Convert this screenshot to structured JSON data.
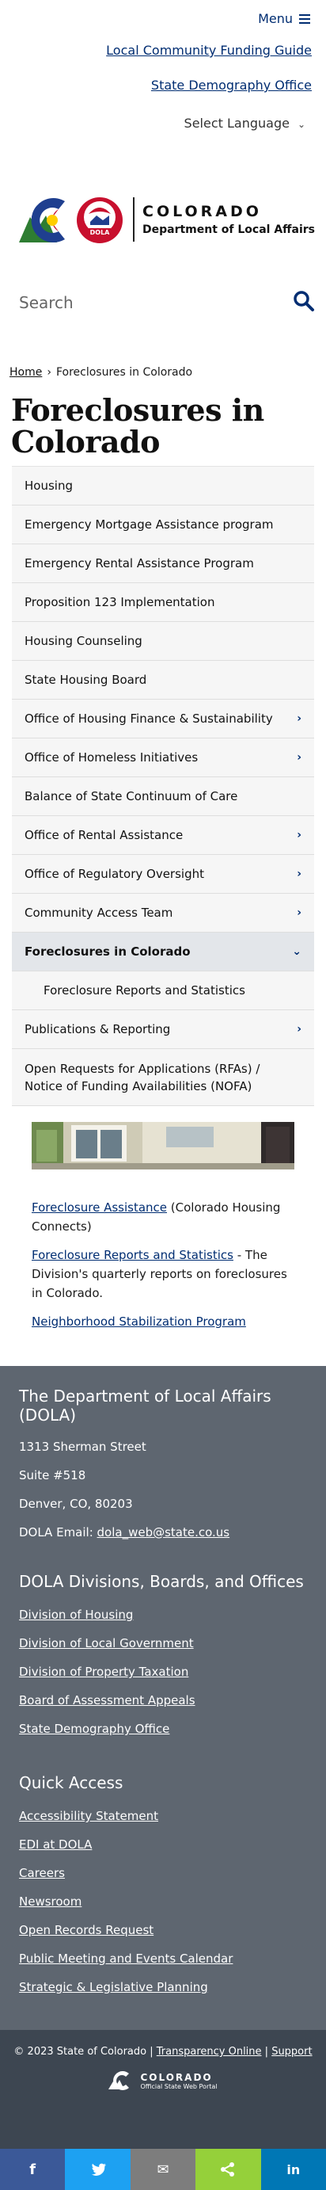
{
  "header": {
    "menu_label": "Menu",
    "links": [
      "Local Community Funding Guide",
      "State Demography Office"
    ],
    "language_label": "Select Language",
    "logo": {
      "name": "COLORADO",
      "department": "Department of Local Affairs",
      "badge": "DOLA"
    }
  },
  "search": {
    "placeholder": "Search"
  },
  "breadcrumb": {
    "home": "Home",
    "current": "Foreclosures in Colorado"
  },
  "page_title": "Foreclosures in Colorado",
  "nav": {
    "items": [
      {
        "label": "Housing",
        "chevron": false
      },
      {
        "label": "Emergency Mortgage Assistance program",
        "chevron": false
      },
      {
        "label": "Emergency Rental Assistance Program",
        "chevron": false
      },
      {
        "label": "Proposition 123 Implementation",
        "chevron": false
      },
      {
        "label": "Housing Counseling",
        "chevron": false
      },
      {
        "label": "State Housing Board",
        "chevron": false
      },
      {
        "label": "Office of Housing Finance & Sustainability",
        "chevron": true
      },
      {
        "label": "Office of Homeless Initiatives",
        "chevron": true
      },
      {
        "label": "Balance of State Continuum of Care",
        "chevron": false
      },
      {
        "label": "Office of Rental Assistance",
        "chevron": true
      },
      {
        "label": "Office of Regulatory Oversight",
        "chevron": true
      },
      {
        "label": "Community Access Team",
        "chevron": true
      },
      {
        "label": "Foreclosures in Colorado",
        "chevron": true,
        "active": true
      },
      {
        "label": "Foreclosure Reports and Statistics",
        "sub": true
      },
      {
        "label": "Publications & Reporting",
        "chevron": true
      },
      {
        "label": "Open Requests for Applications (RFAs) / Notice of Funding Availabilities (NOFA)",
        "chevron": false
      }
    ]
  },
  "content": {
    "p1_link": "Foreclosure Assistance",
    "p1_text": " (Colorado Housing Connects)",
    "p2_link": "Foreclosure Reports and Statistics",
    "p2_text": " - The Division's quarterly reports on foreclosures in Colorado.",
    "p3_link": "Neighborhood Stabilization Program"
  },
  "footer": {
    "dept_title": "The Department of Local Affairs (DOLA)",
    "address_line1": "1313 Sherman Street",
    "address_line2": "Suite  #518",
    "address_line3": "Denver, CO, 80203",
    "email_label": "DOLA Email: ",
    "email": "dola_web@state.co.us",
    "divisions_title": "DOLA Divisions, Boards, and Offices",
    "divisions": [
      "Division of Housing",
      "Division of Local Government",
      "Division of Property Taxation",
      "Board of Assessment Appeals",
      "State Demography Office"
    ],
    "quick_title": "Quick Access",
    "quick": [
      "Accessibility Statement",
      "EDI at DOLA",
      "Careers",
      "Newsroom",
      "Open Records Request",
      "Public Meeting and Events Calendar",
      "Strategic & Legislative Planning"
    ],
    "copyright": "© 2023 State of Colorado",
    "transparency": "Transparency Online",
    "support": "Support",
    "portal_name": "COLORADO",
    "portal_sub": "Official State Web Portal"
  },
  "share": [
    {
      "name": "facebook",
      "glyph": "f",
      "color": "#3b5998"
    },
    {
      "name": "twitter",
      "glyph": "t",
      "color": "#1da1f2"
    },
    {
      "name": "email",
      "glyph": "✉",
      "color": "#7d7d7d"
    },
    {
      "name": "share",
      "glyph": "<",
      "color": "#95d03a"
    },
    {
      "name": "linkedin",
      "glyph": "in",
      "color": "#0077b5"
    }
  ],
  "colors": {
    "brand_navy": "#002d72",
    "footer_bg": "#5e6670",
    "footer_dark": "#3d4651"
  }
}
